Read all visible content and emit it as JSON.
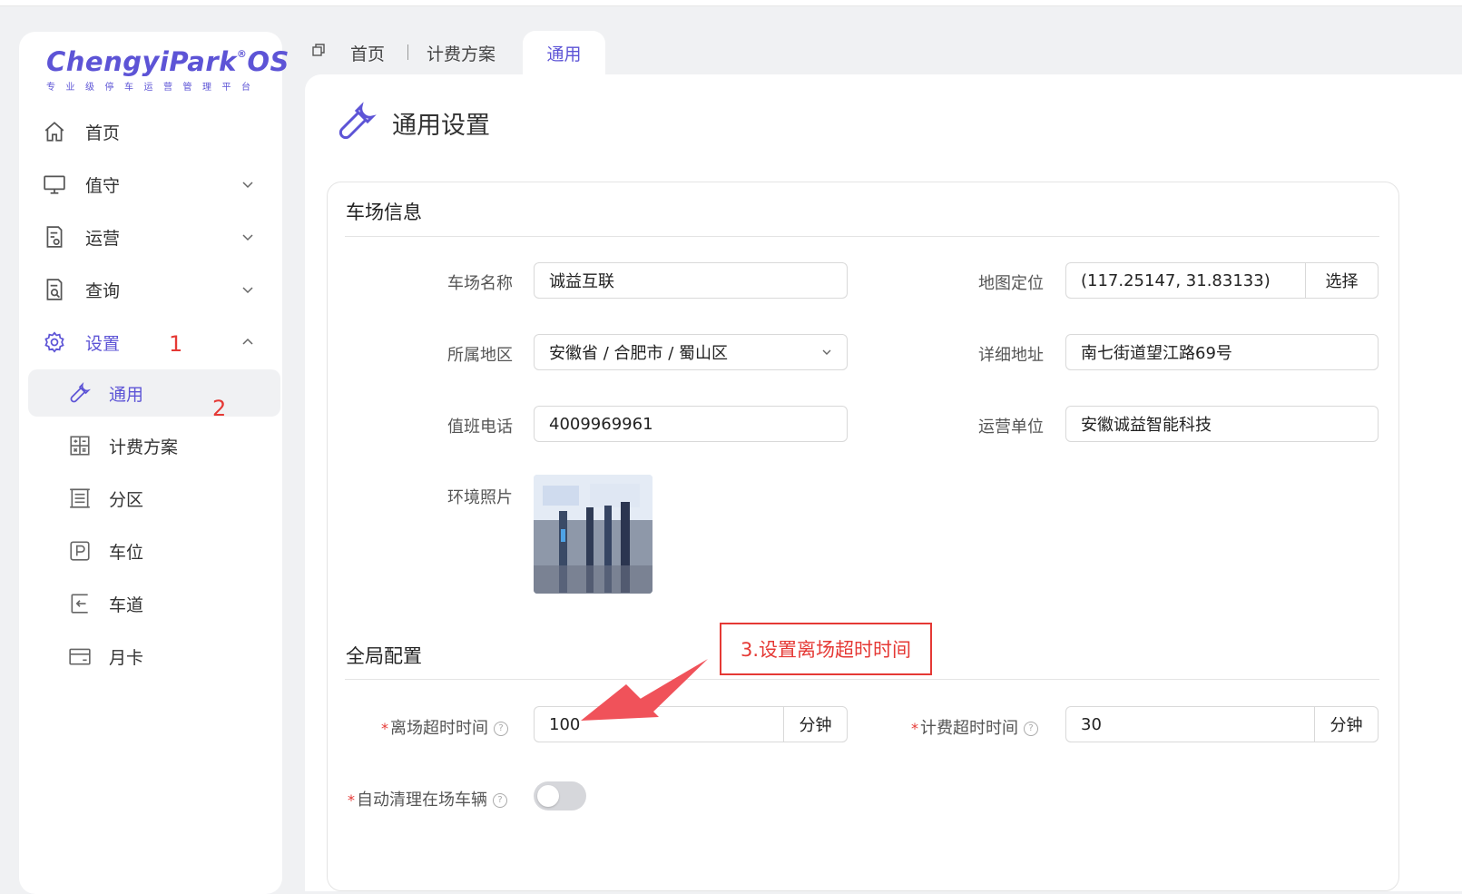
{
  "brand": {
    "name": "ChengyiPark",
    "mark": "®",
    "suffix": "OS",
    "tagline": "专业级停车运营管理平台"
  },
  "sidebar": {
    "items": [
      {
        "label": "首页",
        "icon": "home-icon"
      },
      {
        "label": "值守",
        "icon": "monitor-icon",
        "expandable": true,
        "expanded": false
      },
      {
        "label": "运营",
        "icon": "operation-doc-icon",
        "expandable": true,
        "expanded": false
      },
      {
        "label": "查询",
        "icon": "search-doc-icon",
        "expandable": true,
        "expanded": false
      },
      {
        "label": "设置",
        "icon": "gear-icon",
        "expandable": true,
        "expanded": true,
        "active": true
      }
    ],
    "sub_items": [
      {
        "label": "通用",
        "icon": "wrench-icon",
        "selected": true
      },
      {
        "label": "计费方案",
        "icon": "calculator-icon"
      },
      {
        "label": "分区",
        "icon": "zone-icon"
      },
      {
        "label": "车位",
        "icon": "parking-icon"
      },
      {
        "label": "车道",
        "icon": "lane-icon"
      },
      {
        "label": "月卡",
        "icon": "card-icon"
      }
    ]
  },
  "annotations": {
    "mark1": "1",
    "mark2": "2",
    "callout": "3.设置离场超时时间"
  },
  "tabs": [
    {
      "label": "首页"
    },
    {
      "label": "计费方案"
    },
    {
      "label": "通用",
      "active": true
    }
  ],
  "page": {
    "title": "通用设置"
  },
  "lot_info": {
    "section_title": "车场信息",
    "name_label": "车场名称",
    "name_value": "诚益互联",
    "map_label": "地图定位",
    "map_value": "(117.25147, 31.83133)",
    "map_button": "选择",
    "region_label": "所属地区",
    "region_value": "安徽省 / 合肥市 / 蜀山区",
    "address_label": "详细地址",
    "address_value": "南七街道望江路69号",
    "phone_label": "值班电话",
    "phone_value": "4009969961",
    "operator_label": "运营单位",
    "operator_value": "安徽诚益智能科技",
    "photo_label": "环境照片"
  },
  "global_config": {
    "section_title": "全局配置",
    "leave_timeout_label": "离场超时时间",
    "leave_timeout_value": "100",
    "leave_timeout_unit": "分钟",
    "billing_timeout_label": "计费超时时间",
    "billing_timeout_value": "30",
    "billing_timeout_unit": "分钟",
    "auto_clear_label": "自动清理在场车辆",
    "auto_clear_enabled": false,
    "required_mark": "*",
    "help_mark": "?"
  },
  "colors": {
    "accent": "#5d54d6",
    "annotation": "#e53935",
    "background": "#f0f1f3"
  }
}
